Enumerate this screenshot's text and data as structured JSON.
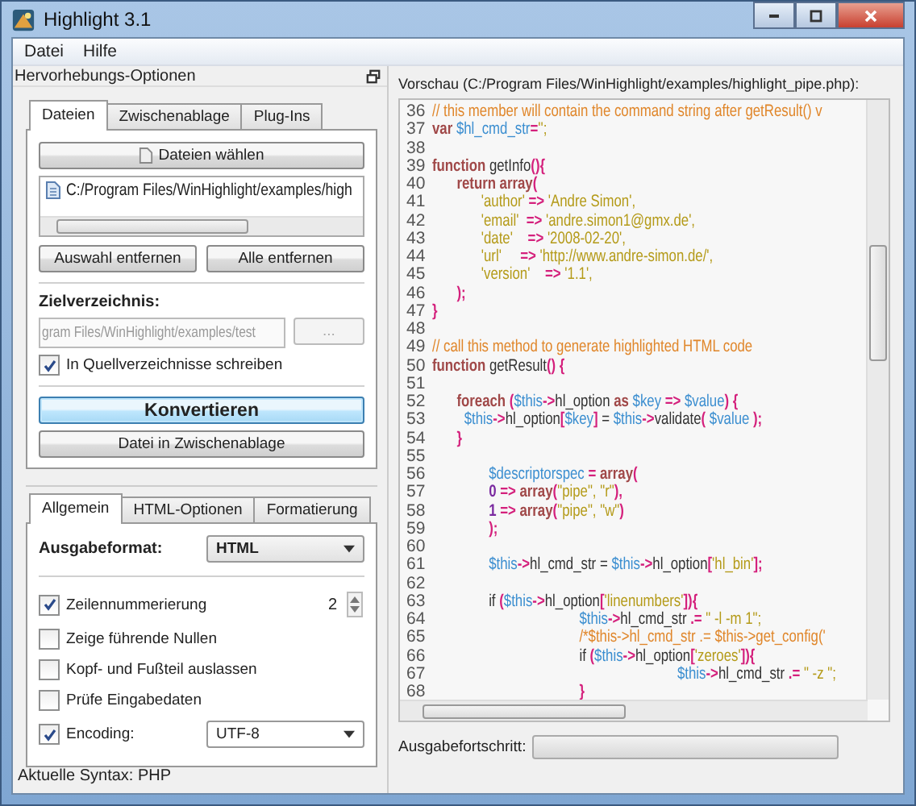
{
  "window": {
    "title": "Highlight 3.1"
  },
  "menu": [
    {
      "label": "Datei"
    },
    {
      "label": "Hilfe"
    }
  ],
  "dock": {
    "title": "Hervorhebungs-Optionen"
  },
  "input_tabs": [
    {
      "label": "Dateien",
      "selected": true
    },
    {
      "label": "Zwischenablage",
      "selected": false
    },
    {
      "label": "Plug-Ins",
      "selected": false
    }
  ],
  "files_panel": {
    "choose_button": "Dateien wählen",
    "files": [
      {
        "path": "C:/Program Files/WinHighlight/examples/high"
      }
    ],
    "remove_selected_button": "Auswahl entfernen",
    "remove_all_button": "Alle entfernen",
    "target_label": "Zielverzeichnis:",
    "target_dir": {
      "value": "gram Files/WinHighlight/examples/test",
      "disabled": true
    },
    "browse_button": {
      "label": "...",
      "disabled": true
    },
    "write_to_source": {
      "label": "In Quellverzeichnisse schreiben",
      "checked": true
    },
    "convert_button": "Konvertieren",
    "clipboard_button": "Datei in Zwischenablage"
  },
  "option_tabs": [
    {
      "label": "Allgemein",
      "selected": true
    },
    {
      "label": "HTML-Optionen",
      "selected": false
    },
    {
      "label": "Formatierung",
      "selected": false
    }
  ],
  "options": {
    "format_label": "Ausgabeformat:",
    "format_value": "HTML",
    "rows": [
      {
        "kind": "spin",
        "label": "Zeilennummerierung",
        "checked": true,
        "value": "2"
      },
      {
        "kind": "checkbox",
        "label": "Zeige führende Nullen",
        "checked": false
      },
      {
        "kind": "checkbox",
        "label": "Kopf- und Fußteil auslassen",
        "checked": false
      },
      {
        "kind": "checkbox",
        "label": "Prüfe Eingabedaten",
        "checked": false
      },
      {
        "kind": "select",
        "label": "Encoding:",
        "checked": true,
        "value": "UTF-8"
      }
    ]
  },
  "status_bar": {
    "text": "Aktuelle Syntax: PHP"
  },
  "preview": {
    "label": "Vorschau (C:/Program Files/WinHighlight/examples/highlight_pipe.php):",
    "lines": [
      {
        "number": "36",
        "tokens": [
          {
            "kind": "comment",
            "text": "// this member will contain the command string after getResult() v"
          }
        ]
      },
      {
        "number": "37",
        "tokens": [
          {
            "kind": "keyword",
            "text": "var "
          },
          {
            "kind": "variable",
            "text": "$hl_cmd_str"
          },
          {
            "kind": "operator",
            "text": "="
          },
          {
            "kind": "string",
            "text": "'';"
          }
        ]
      },
      {
        "number": "38"
      },
      {
        "number": "39",
        "tokens": [
          {
            "kind": "keyword",
            "text": "function "
          },
          {
            "kind": "plain",
            "text": "getInfo"
          },
          {
            "kind": "operator",
            "text": "(){"
          }
        ]
      },
      {
        "number": "40",
        "tokens": [
          {
            "kind": "keyword",
            "text": "\treturn array"
          },
          {
            "kind": "operator",
            "text": "("
          }
        ]
      },
      {
        "number": "41",
        "tokens": [
          {
            "kind": "string",
            "text": "\t\t'author'"
          },
          {
            "kind": "operator",
            "text": " => "
          },
          {
            "kind": "string",
            "text": "'Andre Simon',"
          }
        ]
      },
      {
        "number": "42",
        "tokens": [
          {
            "kind": "string",
            "text": "\t\t'email'"
          },
          {
            "kind": "operator",
            "text": "  => "
          },
          {
            "kind": "string",
            "text": "'andre.simon1@gmx.de',"
          }
        ]
      },
      {
        "number": "43",
        "tokens": [
          {
            "kind": "string",
            "text": "\t\t'date'"
          },
          {
            "kind": "operator",
            "text": "    => "
          },
          {
            "kind": "string",
            "text": "'2008-02-20',"
          }
        ]
      },
      {
        "number": "44",
        "tokens": [
          {
            "kind": "string",
            "text": "\t\t'url'"
          },
          {
            "kind": "operator",
            "text": "     => "
          },
          {
            "kind": "string",
            "text": "'http://www.andre-simon.de/',"
          }
        ]
      },
      {
        "number": "45",
        "tokens": [
          {
            "kind": "string",
            "text": "\t\t'version'"
          },
          {
            "kind": "operator",
            "text": "    => "
          },
          {
            "kind": "string",
            "text": "'1.1',"
          }
        ]
      },
      {
        "number": "46",
        "tokens": [
          {
            "kind": "operator",
            "text": "\t);"
          }
        ]
      },
      {
        "number": "47",
        "tokens": [
          {
            "kind": "operator",
            "text": "}"
          }
        ]
      },
      {
        "number": "48"
      },
      {
        "number": "49",
        "tokens": [
          {
            "kind": "comment",
            "text": "// call this method to generate highlighted HTML code"
          }
        ]
      },
      {
        "number": "50",
        "tokens": [
          {
            "kind": "keyword",
            "text": "function "
          },
          {
            "kind": "plain",
            "text": "getResult"
          },
          {
            "kind": "operator",
            "text": "() {"
          }
        ]
      },
      {
        "number": "51"
      },
      {
        "number": "52",
        "tokens": [
          {
            "kind": "keyword",
            "text": "\tforeach "
          },
          {
            "kind": "operator",
            "text": "("
          },
          {
            "kind": "variable",
            "text": "$this"
          },
          {
            "kind": "operator",
            "text": "->"
          },
          {
            "kind": "plain",
            "text": "hl_option "
          },
          {
            "kind": "keyword",
            "text": "as "
          },
          {
            "kind": "variable",
            "text": "$key "
          },
          {
            "kind": "operator",
            "text": "=> "
          },
          {
            "kind": "variable",
            "text": "$value"
          },
          {
            "kind": "operator",
            "text": ") {"
          }
        ]
      },
      {
        "number": "53",
        "tokens": [
          {
            "kind": "variable",
            "text": "\t  $this"
          },
          {
            "kind": "operator",
            "text": "->"
          },
          {
            "kind": "plain",
            "text": "hl_option"
          },
          {
            "kind": "operator",
            "text": "["
          },
          {
            "kind": "variable",
            "text": "$key"
          },
          {
            "kind": "operator",
            "text": "] "
          },
          {
            "kind": "plain",
            "text": "= "
          },
          {
            "kind": "variable",
            "text": "$this"
          },
          {
            "kind": "operator",
            "text": "->"
          },
          {
            "kind": "plain",
            "text": "validate"
          },
          {
            "kind": "operator",
            "text": "( "
          },
          {
            "kind": "variable",
            "text": "$value "
          },
          {
            "kind": "operator",
            "text": ");"
          }
        ]
      },
      {
        "number": "54",
        "tokens": [
          {
            "kind": "operator",
            "text": "\t}"
          }
        ]
      },
      {
        "number": "55"
      },
      {
        "number": "56",
        "tokens": [
          {
            "kind": "variable",
            "text": "\t\t  $descriptorspec "
          },
          {
            "kind": "operator",
            "text": "= "
          },
          {
            "kind": "keyword",
            "text": "array"
          },
          {
            "kind": "operator",
            "text": "("
          }
        ]
      },
      {
        "number": "57",
        "tokens": [
          {
            "kind": "number",
            "text": "\t\t  0 "
          },
          {
            "kind": "operator",
            "text": "=> "
          },
          {
            "kind": "keyword",
            "text": "array"
          },
          {
            "kind": "operator",
            "text": "("
          },
          {
            "kind": "string",
            "text": "\"pipe\", \"r\""
          },
          {
            "kind": "operator",
            "text": "),"
          }
        ]
      },
      {
        "number": "58",
        "tokens": [
          {
            "kind": "number",
            "text": "\t\t  1 "
          },
          {
            "kind": "operator",
            "text": "=> "
          },
          {
            "kind": "keyword",
            "text": "array"
          },
          {
            "kind": "operator",
            "text": "("
          },
          {
            "kind": "string",
            "text": "\"pipe\", \"w\""
          },
          {
            "kind": "operator",
            "text": ")"
          }
        ]
      },
      {
        "number": "59",
        "tokens": [
          {
            "kind": "operator",
            "text": "\t\t  );"
          }
        ]
      },
      {
        "number": "60"
      },
      {
        "number": "61",
        "tokens": [
          {
            "kind": "variable",
            "text": "\t\t  $this"
          },
          {
            "kind": "operator",
            "text": "->"
          },
          {
            "kind": "plain",
            "text": "hl_cmd_str = "
          },
          {
            "kind": "variable",
            "text": "$this"
          },
          {
            "kind": "operator",
            "text": "->"
          },
          {
            "kind": "plain",
            "text": "hl_option"
          },
          {
            "kind": "operator",
            "text": "["
          },
          {
            "kind": "string",
            "text": "'hl_bin'"
          },
          {
            "kind": "operator",
            "text": "];"
          }
        ]
      },
      {
        "number": "62"
      },
      {
        "number": "63",
        "tokens": [
          {
            "kind": "plain",
            "text": "\t\t  if "
          },
          {
            "kind": "operator",
            "text": "("
          },
          {
            "kind": "variable",
            "text": "$this"
          },
          {
            "kind": "operator",
            "text": "->"
          },
          {
            "kind": "plain",
            "text": "hl_option"
          },
          {
            "kind": "operator",
            "text": "["
          },
          {
            "kind": "string",
            "text": "'linenumbers'"
          },
          {
            "kind": "operator",
            "text": "]){"
          }
        ]
      },
      {
        "number": "64",
        "tokens": [
          {
            "kind": "variable",
            "text": "\t\t\t\t\t\t$this"
          },
          {
            "kind": "operator",
            "text": "->"
          },
          {
            "kind": "plain",
            "text": "hl_cmd_str "
          },
          {
            "kind": "operator",
            "text": ".= "
          },
          {
            "kind": "string",
            "text": "\" -l -m 1\";"
          }
        ]
      },
      {
        "number": "65",
        "tokens": [
          {
            "kind": "comment",
            "text": "\t\t\t\t\t\t/*$this->hl_cmd_str .= $this->get_config('"
          }
        ]
      },
      {
        "number": "66",
        "tokens": [
          {
            "kind": "plain",
            "text": "\t\t\t\t\t\tif "
          },
          {
            "kind": "operator",
            "text": "("
          },
          {
            "kind": "variable",
            "text": "$this"
          },
          {
            "kind": "operator",
            "text": "->"
          },
          {
            "kind": "plain",
            "text": "hl_option"
          },
          {
            "kind": "operator",
            "text": "["
          },
          {
            "kind": "string",
            "text": "'zeroes'"
          },
          {
            "kind": "operator",
            "text": "]){"
          }
        ]
      },
      {
        "number": "67",
        "tokens": [
          {
            "kind": "variable",
            "text": "\t\t\t\t\t\t\t\t\t\t$this"
          },
          {
            "kind": "operator",
            "text": "->"
          },
          {
            "kind": "plain",
            "text": "hl_cmd_str "
          },
          {
            "kind": "operator",
            "text": ".= "
          },
          {
            "kind": "string",
            "text": "\" -z \";"
          }
        ]
      },
      {
        "number": "68",
        "tokens": [
          {
            "kind": "operator",
            "text": "\t\t\t\t\t\t}"
          }
        ]
      }
    ]
  },
  "progress": {
    "label": "Ausgabefortschritt:",
    "level": 0
  }
}
